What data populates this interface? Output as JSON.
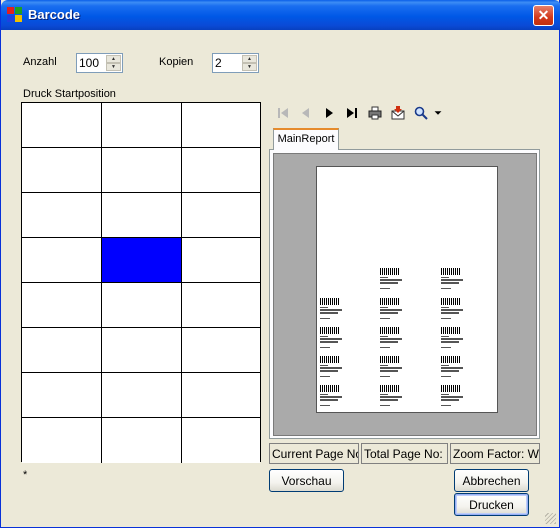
{
  "window": {
    "title": "Barcode",
    "close_label": "✕"
  },
  "form": {
    "anzahl_label": "Anzahl",
    "anzahl_value": "100",
    "kopien_label": "Kopien",
    "kopien_value": "2",
    "startpos_label": "Druck Startposition",
    "grid": {
      "rows": 8,
      "cols": 3,
      "selected": [
        3,
        1
      ]
    },
    "asterisk": "*"
  },
  "report": {
    "toolbar": [
      "first-page-icon",
      "prev-page-icon",
      "next-page-icon",
      "last-page-icon",
      "print-icon",
      "export-icon",
      "zoom-icon",
      "dropdown-arrow-icon"
    ],
    "tab_label": "MainReport",
    "status": {
      "current_page": "Current Page No",
      "total_page": "Total Page No:",
      "zoom": "Zoom Factor: W"
    }
  },
  "buttons": {
    "preview": "Vorschau",
    "cancel": "Abbrechen",
    "print": "Drucken"
  }
}
